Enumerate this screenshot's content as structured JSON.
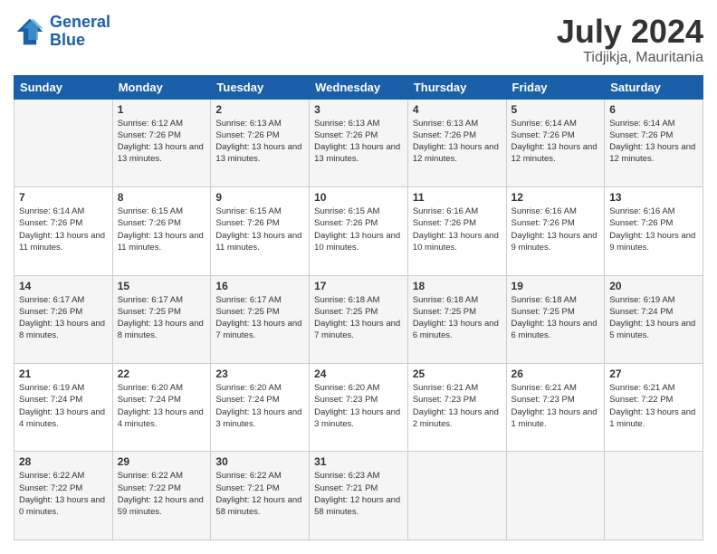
{
  "logo": {
    "line1": "General",
    "line2": "Blue"
  },
  "title": "July 2024",
  "subtitle": "Tidjikja, Mauritania",
  "weekdays": [
    "Sunday",
    "Monday",
    "Tuesday",
    "Wednesday",
    "Thursday",
    "Friday",
    "Saturday"
  ],
  "weeks": [
    [
      {
        "day": "",
        "sunrise": "",
        "sunset": "",
        "daylight": ""
      },
      {
        "day": "1",
        "sunrise": "Sunrise: 6:12 AM",
        "sunset": "Sunset: 7:26 PM",
        "daylight": "Daylight: 13 hours and 13 minutes."
      },
      {
        "day": "2",
        "sunrise": "Sunrise: 6:13 AM",
        "sunset": "Sunset: 7:26 PM",
        "daylight": "Daylight: 13 hours and 13 minutes."
      },
      {
        "day": "3",
        "sunrise": "Sunrise: 6:13 AM",
        "sunset": "Sunset: 7:26 PM",
        "daylight": "Daylight: 13 hours and 13 minutes."
      },
      {
        "day": "4",
        "sunrise": "Sunrise: 6:13 AM",
        "sunset": "Sunset: 7:26 PM",
        "daylight": "Daylight: 13 hours and 12 minutes."
      },
      {
        "day": "5",
        "sunrise": "Sunrise: 6:14 AM",
        "sunset": "Sunset: 7:26 PM",
        "daylight": "Daylight: 13 hours and 12 minutes."
      },
      {
        "day": "6",
        "sunrise": "Sunrise: 6:14 AM",
        "sunset": "Sunset: 7:26 PM",
        "daylight": "Daylight: 13 hours and 12 minutes."
      }
    ],
    [
      {
        "day": "7",
        "sunrise": "Sunrise: 6:14 AM",
        "sunset": "Sunset: 7:26 PM",
        "daylight": "Daylight: 13 hours and 11 minutes."
      },
      {
        "day": "8",
        "sunrise": "Sunrise: 6:15 AM",
        "sunset": "Sunset: 7:26 PM",
        "daylight": "Daylight: 13 hours and 11 minutes."
      },
      {
        "day": "9",
        "sunrise": "Sunrise: 6:15 AM",
        "sunset": "Sunset: 7:26 PM",
        "daylight": "Daylight: 13 hours and 11 minutes."
      },
      {
        "day": "10",
        "sunrise": "Sunrise: 6:15 AM",
        "sunset": "Sunset: 7:26 PM",
        "daylight": "Daylight: 13 hours and 10 minutes."
      },
      {
        "day": "11",
        "sunrise": "Sunrise: 6:16 AM",
        "sunset": "Sunset: 7:26 PM",
        "daylight": "Daylight: 13 hours and 10 minutes."
      },
      {
        "day": "12",
        "sunrise": "Sunrise: 6:16 AM",
        "sunset": "Sunset: 7:26 PM",
        "daylight": "Daylight: 13 hours and 9 minutes."
      },
      {
        "day": "13",
        "sunrise": "Sunrise: 6:16 AM",
        "sunset": "Sunset: 7:26 PM",
        "daylight": "Daylight: 13 hours and 9 minutes."
      }
    ],
    [
      {
        "day": "14",
        "sunrise": "Sunrise: 6:17 AM",
        "sunset": "Sunset: 7:26 PM",
        "daylight": "Daylight: 13 hours and 8 minutes."
      },
      {
        "day": "15",
        "sunrise": "Sunrise: 6:17 AM",
        "sunset": "Sunset: 7:25 PM",
        "daylight": "Daylight: 13 hours and 8 minutes."
      },
      {
        "day": "16",
        "sunrise": "Sunrise: 6:17 AM",
        "sunset": "Sunset: 7:25 PM",
        "daylight": "Daylight: 13 hours and 7 minutes."
      },
      {
        "day": "17",
        "sunrise": "Sunrise: 6:18 AM",
        "sunset": "Sunset: 7:25 PM",
        "daylight": "Daylight: 13 hours and 7 minutes."
      },
      {
        "day": "18",
        "sunrise": "Sunrise: 6:18 AM",
        "sunset": "Sunset: 7:25 PM",
        "daylight": "Daylight: 13 hours and 6 minutes."
      },
      {
        "day": "19",
        "sunrise": "Sunrise: 6:18 AM",
        "sunset": "Sunset: 7:25 PM",
        "daylight": "Daylight: 13 hours and 6 minutes."
      },
      {
        "day": "20",
        "sunrise": "Sunrise: 6:19 AM",
        "sunset": "Sunset: 7:24 PM",
        "daylight": "Daylight: 13 hours and 5 minutes."
      }
    ],
    [
      {
        "day": "21",
        "sunrise": "Sunrise: 6:19 AM",
        "sunset": "Sunset: 7:24 PM",
        "daylight": "Daylight: 13 hours and 4 minutes."
      },
      {
        "day": "22",
        "sunrise": "Sunrise: 6:20 AM",
        "sunset": "Sunset: 7:24 PM",
        "daylight": "Daylight: 13 hours and 4 minutes."
      },
      {
        "day": "23",
        "sunrise": "Sunrise: 6:20 AM",
        "sunset": "Sunset: 7:24 PM",
        "daylight": "Daylight: 13 hours and 3 minutes."
      },
      {
        "day": "24",
        "sunrise": "Sunrise: 6:20 AM",
        "sunset": "Sunset: 7:23 PM",
        "daylight": "Daylight: 13 hours and 3 minutes."
      },
      {
        "day": "25",
        "sunrise": "Sunrise: 6:21 AM",
        "sunset": "Sunset: 7:23 PM",
        "daylight": "Daylight: 13 hours and 2 minutes."
      },
      {
        "day": "26",
        "sunrise": "Sunrise: 6:21 AM",
        "sunset": "Sunset: 7:23 PM",
        "daylight": "Daylight: 13 hours and 1 minute."
      },
      {
        "day": "27",
        "sunrise": "Sunrise: 6:21 AM",
        "sunset": "Sunset: 7:22 PM",
        "daylight": "Daylight: 13 hours and 1 minute."
      }
    ],
    [
      {
        "day": "28",
        "sunrise": "Sunrise: 6:22 AM",
        "sunset": "Sunset: 7:22 PM",
        "daylight": "Daylight: 13 hours and 0 minutes."
      },
      {
        "day": "29",
        "sunrise": "Sunrise: 6:22 AM",
        "sunset": "Sunset: 7:22 PM",
        "daylight": "Daylight: 12 hours and 59 minutes."
      },
      {
        "day": "30",
        "sunrise": "Sunrise: 6:22 AM",
        "sunset": "Sunset: 7:21 PM",
        "daylight": "Daylight: 12 hours and 58 minutes."
      },
      {
        "day": "31",
        "sunrise": "Sunrise: 6:23 AM",
        "sunset": "Sunset: 7:21 PM",
        "daylight": "Daylight: 12 hours and 58 minutes."
      },
      {
        "day": "",
        "sunrise": "",
        "sunset": "",
        "daylight": ""
      },
      {
        "day": "",
        "sunrise": "",
        "sunset": "",
        "daylight": ""
      },
      {
        "day": "",
        "sunrise": "",
        "sunset": "",
        "daylight": ""
      }
    ]
  ]
}
